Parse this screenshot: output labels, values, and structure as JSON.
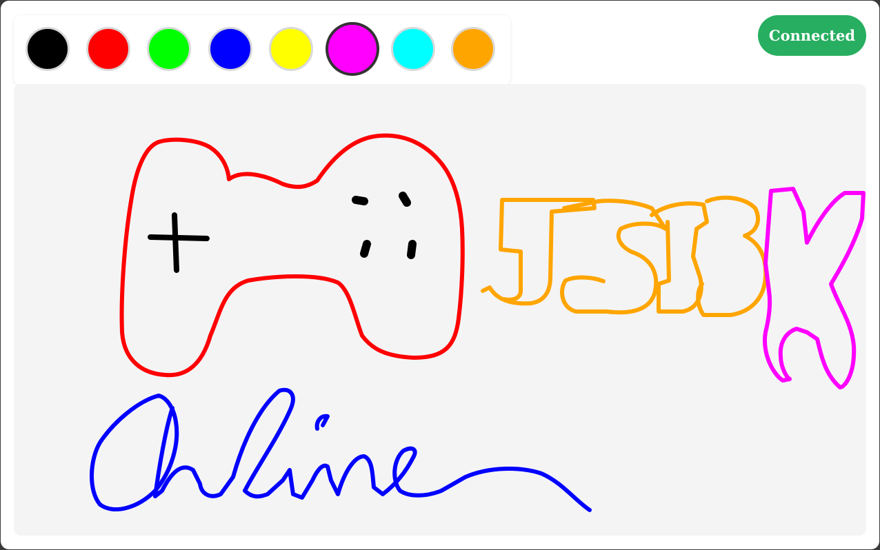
{
  "palette": {
    "selected_index": 5,
    "colors": [
      {
        "name": "black",
        "hex": "#000000"
      },
      {
        "name": "red",
        "hex": "#ff0000"
      },
      {
        "name": "green",
        "hex": "#00ff00"
      },
      {
        "name": "blue",
        "hex": "#0000ff"
      },
      {
        "name": "yellow",
        "hex": "#ffff00"
      },
      {
        "name": "magenta",
        "hex": "#ff00ff"
      },
      {
        "name": "cyan",
        "hex": "#00ffff"
      },
      {
        "name": "orange",
        "hex": "#ffa500"
      }
    ]
  },
  "status": {
    "label": "Connected",
    "color": "#27ae60"
  },
  "canvas": {
    "background": "#f4f4f5",
    "stroke_colors": {
      "controller": "#ff0000",
      "controller_buttons": "#000000",
      "text_orange": "#ffa500",
      "text_magenta": "#ff00ff",
      "text_blue": "#0000ff"
    }
  }
}
